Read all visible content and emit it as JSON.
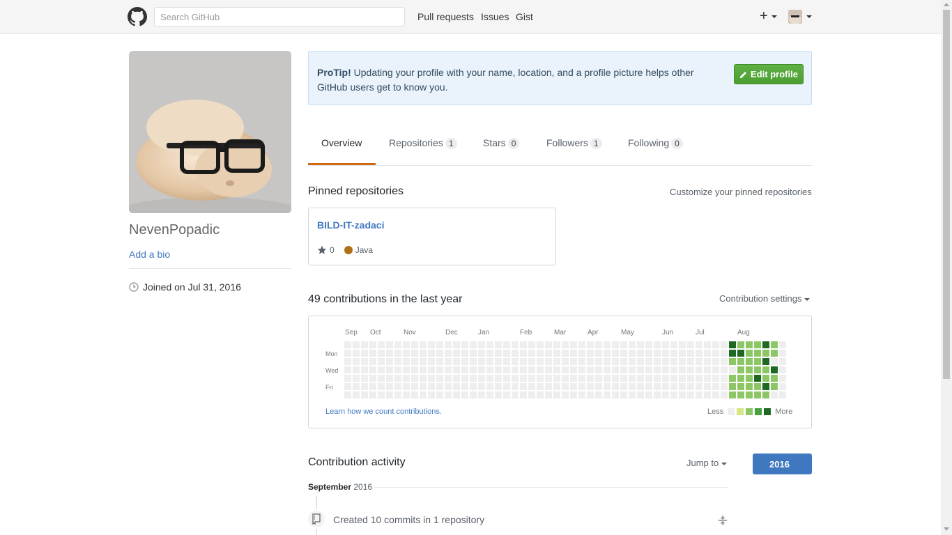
{
  "header": {
    "search_placeholder": "Search GitHub",
    "nav": [
      "Pull requests",
      "Issues",
      "Gist"
    ],
    "new_label": "+"
  },
  "profile": {
    "username": "NevenPopadic",
    "add_bio": "Add a bio",
    "joined": "Joined on Jul 31, 2016"
  },
  "protip": {
    "bold": "ProTip!",
    "text": "Updating your profile with your name, location, and a profile picture helps other GitHub users get to know you.",
    "button": "Edit profile"
  },
  "tabs": [
    {
      "label": "Overview",
      "count": ""
    },
    {
      "label": "Repositories",
      "count": "1"
    },
    {
      "label": "Stars",
      "count": "0"
    },
    {
      "label": "Followers",
      "count": "1"
    },
    {
      "label": "Following",
      "count": "0"
    }
  ],
  "pinned": {
    "title": "Pinned repositories",
    "customize": "Customize your pinned repositories",
    "repo": {
      "name": "BILD-IT-zadaci",
      "stars": "0",
      "language": "Java",
      "language_color": "#b07219"
    }
  },
  "contributions": {
    "title": "49 contributions in the last year",
    "settings": "Contribution settings",
    "months": [
      "Sep",
      "Oct",
      "Nov",
      "Dec",
      "Jan",
      "Feb",
      "Mar",
      "Apr",
      "May",
      "Jun",
      "Jul",
      "Aug"
    ],
    "days": [
      "Mon",
      "Wed",
      "Fri"
    ],
    "learn": "Learn how we count contributions.",
    "less": "Less",
    "more": "More",
    "colors": [
      "#eeeeee",
      "#d6e685",
      "#8cc665",
      "#44a340",
      "#1e6823"
    ],
    "active_weeks": [
      [
        4,
        4,
        2,
        0,
        2,
        2,
        2
      ],
      [
        2,
        4,
        2,
        2,
        2,
        2,
        2
      ],
      [
        2,
        2,
        2,
        2,
        2,
        2,
        2
      ],
      [
        2,
        2,
        2,
        2,
        4,
        2,
        2
      ],
      [
        4,
        2,
        4,
        2,
        2,
        4,
        2
      ],
      [
        2,
        2,
        0,
        4,
        2,
        2,
        0
      ],
      [
        0,
        0,
        0,
        0,
        0,
        0,
        0
      ]
    ]
  },
  "activity": {
    "title": "Contribution activity",
    "jump": "Jump to",
    "year": "2016",
    "month": "September",
    "month_year": "2016",
    "item": "Created 10 commits in 1 repository"
  }
}
